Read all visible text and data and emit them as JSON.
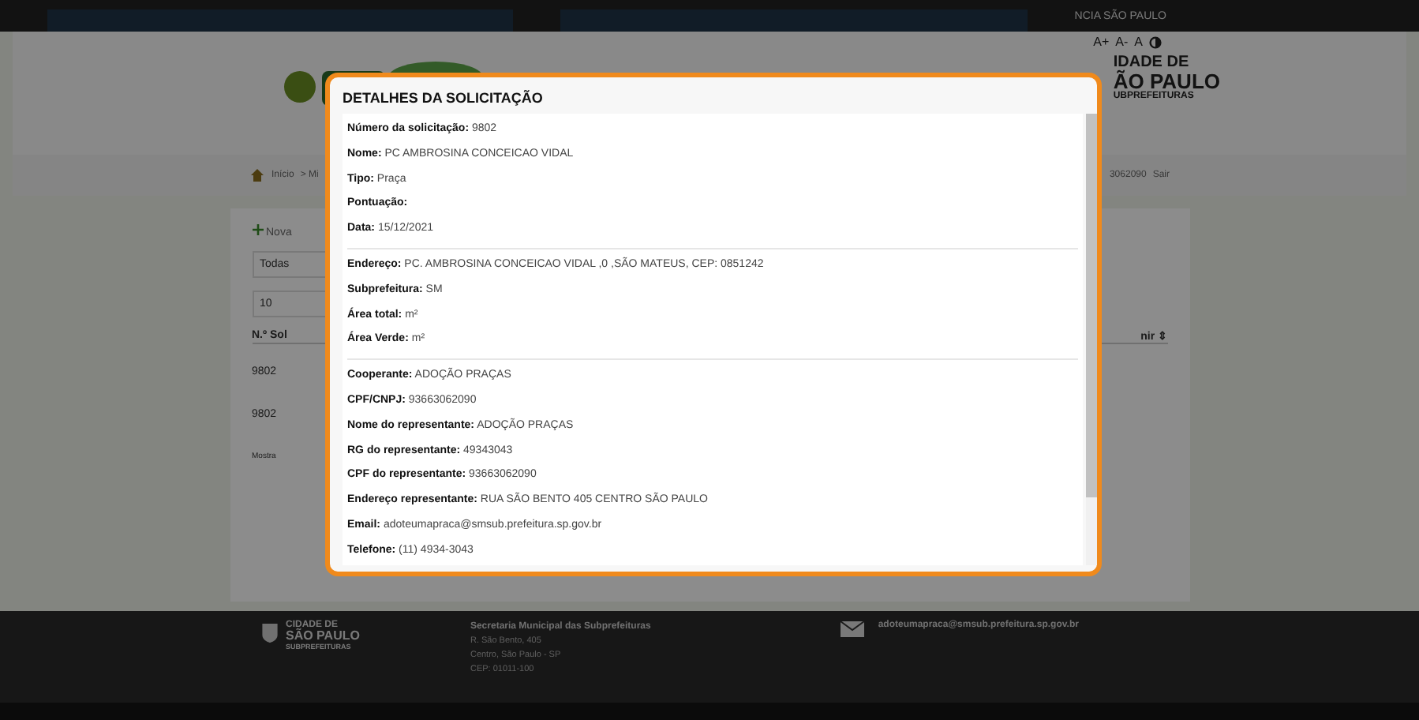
{
  "top_bar": {
    "location": "NCIA SÃO PAULO",
    "font_controls": [
      "A+",
      "A-",
      "A"
    ]
  },
  "header": {
    "city_logo_lines": [
      "IDADE DE",
      "ÃO PAULO",
      "UBPREFEITURAS"
    ]
  },
  "breadcrumb": {
    "items": [
      "Início",
      "> Mi"
    ],
    "user_id": "3062090",
    "logout": "Sair"
  },
  "content": {
    "new_button": "Nova",
    "filter_value": "Todas",
    "page_size": "10",
    "column_1": "N.º Sol",
    "column_last": "nir ⇕",
    "rows": [
      "9802",
      "9802"
    ],
    "footer_text": "Mostra"
  },
  "modal": {
    "title": "DETALHES DA SOLICITAÇÃO",
    "sections": [
      [
        "**Número da solicitação:** 9802",
        "**Nome:** PC AMBROSINA CONCEICAO VIDAL",
        "**Tipo:** Praça",
        "**Pontuação:**",
        "**Data:** 15/12/2021"
      ],
      [
        "**Endereço:** PC. AMBROSINA CONCEICAO VIDAL ,0 ,SÃO MATEUS, CEP: 0851242",
        "**Subprefeitura:** SM",
        "**Área total:** m²",
        "**Área Verde:** m²"
      ],
      [
        "**Cooperante:** ADOÇÃO PRAÇAS",
        "**CPF/CNPJ:** 93663062090",
        "**Nome do representante:** ADOÇÃO PRAÇAS",
        "**RG do representante:** 49343043",
        "**CPF do representante:** 93663062090",
        "**Endereço representante:** RUA SÃO BENTO 405 CENTRO SÃO PAULO",
        "**Email:** adoteumapraca@smsub.prefeitura.sp.gov.br",
        "**Telefone:** (11) 4934-3043"
      ]
    ]
  },
  "footer": {
    "logo_lines": [
      "CIDADE DE",
      "SÃO PAULO",
      "SUBPREFEITURAS"
    ],
    "org": "Secretaria Municipal das Subprefeituras",
    "address": [
      "R. São Bento, 405",
      "Centro, São Paulo - SP",
      "CEP: 01011-100"
    ],
    "email": "adoteumapraca@smsub.prefeitura.sp.gov.br"
  }
}
